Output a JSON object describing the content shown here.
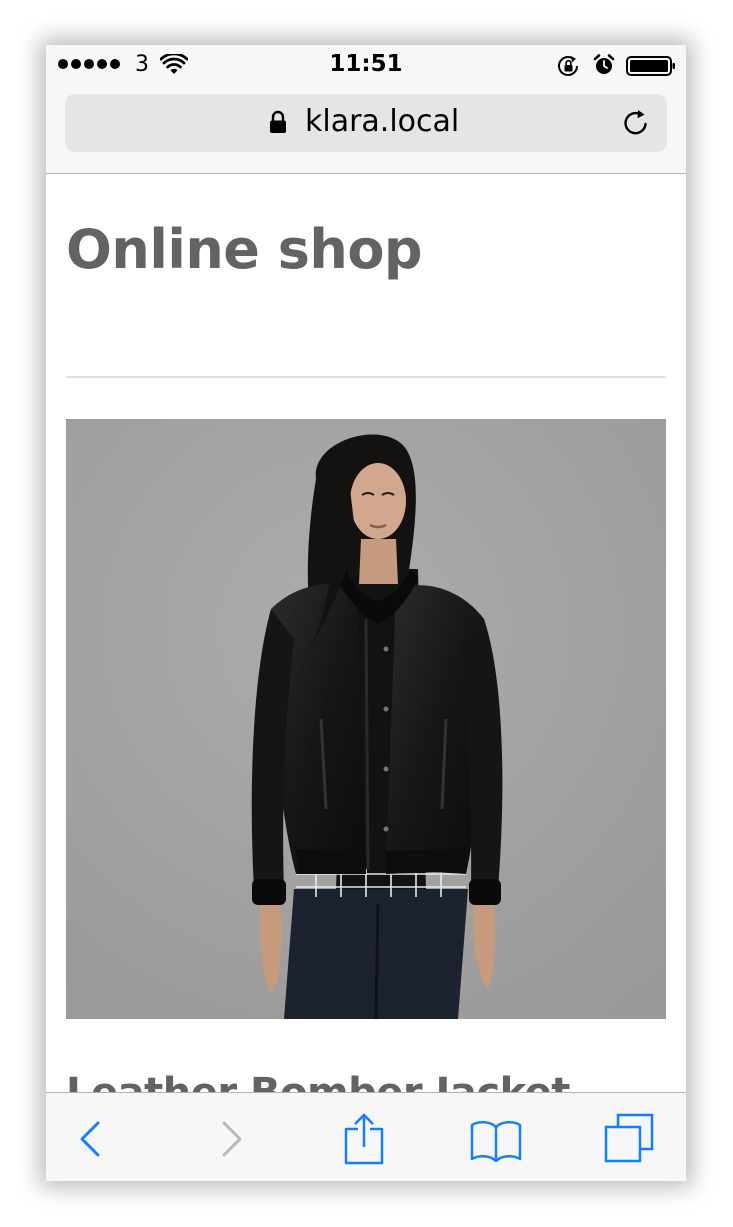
{
  "status_bar": {
    "carrier": "3",
    "time": "11:51",
    "signal_bars": 5
  },
  "address_bar": {
    "url": "klara.local"
  },
  "page": {
    "title": "Online shop",
    "product": {
      "name": "Leather Bomber Jacket",
      "image_description_icon": "product-photo"
    }
  },
  "toolbar": {
    "back_enabled": true,
    "forward_enabled": false
  },
  "colors": {
    "ios_blue": "#157efb",
    "disabled_gray": "#b8b8b8",
    "heading_gray": "#636363"
  }
}
